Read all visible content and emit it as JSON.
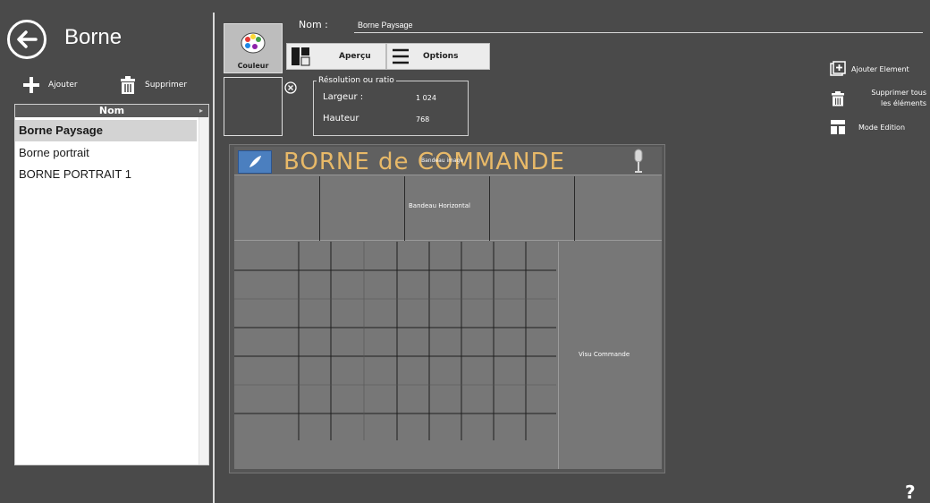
{
  "left_panel": {
    "title": "Borne",
    "add_label": "Ajouter",
    "delete_label": "Supprimer",
    "list_header": "Nom",
    "items": [
      {
        "label": "Borne Paysage",
        "selected": true
      },
      {
        "label": "Borne portrait",
        "selected": false
      },
      {
        "label": "BORNE PORTRAIT 1",
        "selected": false
      }
    ]
  },
  "editor": {
    "name_label": "Nom :",
    "name_value": "Borne Paysage",
    "couleur_label": "Couleur",
    "tabs": {
      "apercu": "Aperçu",
      "options": "Options"
    },
    "resolution": {
      "legend": "Résolution ou ratio",
      "width_label": "Largeur :",
      "width_value": "1 024",
      "height_label": "Hauteur",
      "height_value": "768"
    }
  },
  "canvas": {
    "banner_title": "BORNE de COMMANDE",
    "banner_image_label": "Bandeau image",
    "bandeau_label": "Bandeau Horizontal",
    "visu_label": "Visu Commande"
  },
  "right_actions": {
    "add_element": "Ajouter Element",
    "delete_all": "Supprimer tous\nles éléments",
    "mode_edition": "Mode Edition"
  },
  "help": "?",
  "colors": {
    "background": "#4a4a4a",
    "banner_text": "#e8b968",
    "selected_row": "#d3d3d3"
  }
}
